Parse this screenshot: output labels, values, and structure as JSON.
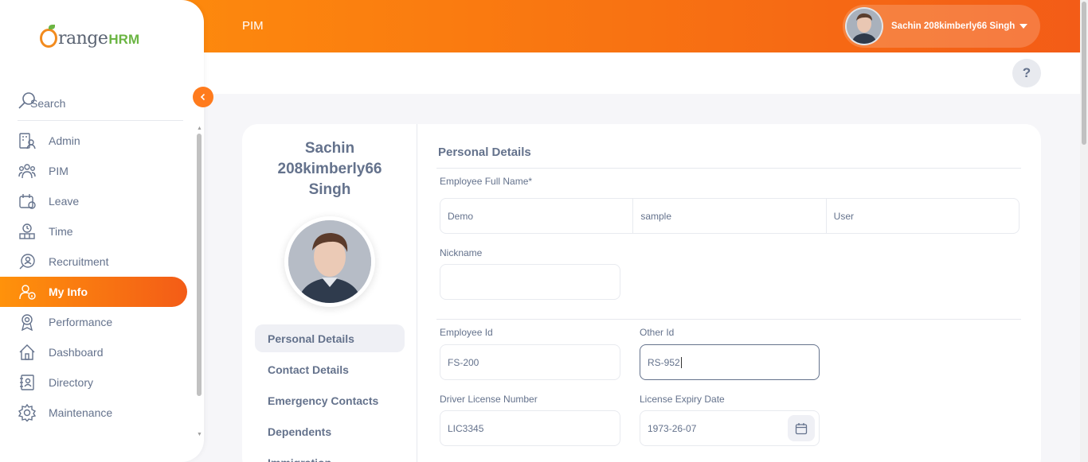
{
  "header": {
    "module_title": "PIM",
    "user_name": "Sachin 208kimberly66 Singh",
    "help_label": "?"
  },
  "brand": {
    "part1": "range",
    "part2": "HRM"
  },
  "sidebar": {
    "search_label": "Search",
    "items": [
      {
        "label": "Admin",
        "icon": "admin-icon"
      },
      {
        "label": "PIM",
        "icon": "pim-icon"
      },
      {
        "label": "Leave",
        "icon": "leave-icon"
      },
      {
        "label": "Time",
        "icon": "time-icon"
      },
      {
        "label": "Recruitment",
        "icon": "recruitment-icon"
      },
      {
        "label": "My Info",
        "icon": "my-info-icon"
      },
      {
        "label": "Performance",
        "icon": "performance-icon"
      },
      {
        "label": "Dashboard",
        "icon": "dashboard-icon"
      },
      {
        "label": "Directory",
        "icon": "directory-icon"
      },
      {
        "label": "Maintenance",
        "icon": "maintenance-icon"
      }
    ],
    "active_item": "My Info"
  },
  "profile": {
    "name_line1": "Sachin",
    "name_line2": "208kimberly66",
    "name_line3": "Singh",
    "tabs": [
      {
        "label": "Personal Details"
      },
      {
        "label": "Contact Details"
      },
      {
        "label": "Emergency Contacts"
      },
      {
        "label": "Dependents"
      },
      {
        "label": "Immigration"
      }
    ]
  },
  "form": {
    "section_title": "Personal Details",
    "full_name_label": "Employee Full Name*",
    "first_name": "Demo",
    "middle_name": "sample",
    "last_name": "User",
    "nickname_label": "Nickname",
    "nickname": "",
    "employee_id_label": "Employee Id",
    "employee_id": "FS-200",
    "other_id_label": "Other Id",
    "other_id": "RS-952",
    "license_label": "Driver License Number",
    "license": "LIC3345",
    "expiry_label": "License Expiry Date",
    "expiry": "1973-26-07"
  },
  "colors": {
    "accent_start": "#ff920b",
    "accent_end": "#f35c17",
    "text": "#64728c"
  }
}
